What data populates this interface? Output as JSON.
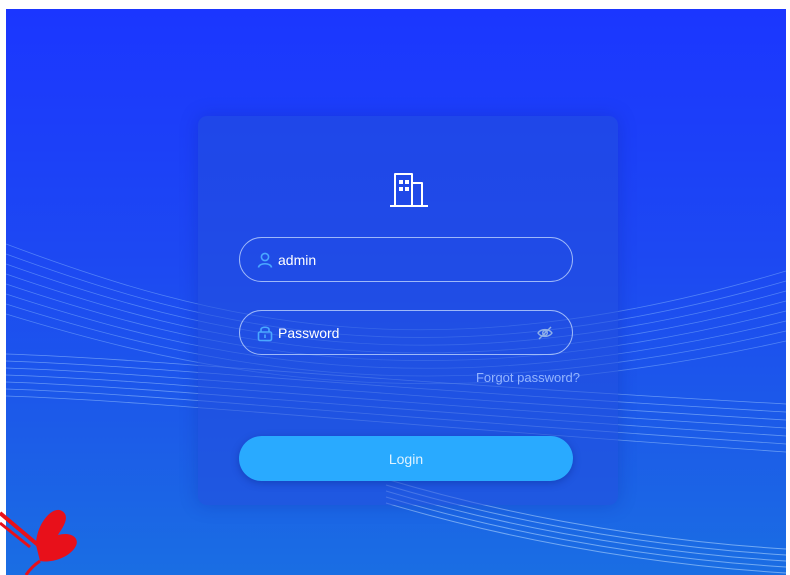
{
  "login": {
    "username_value": "admin",
    "password_placeholder": "Password",
    "forgot_label": "Forgot password?",
    "login_label": "Login"
  },
  "icons": {
    "logo": "building-icon",
    "username": "user-icon",
    "password": "lock-icon",
    "visibility": "eye-off-icon",
    "corner": "butterfly-icon"
  },
  "colors": {
    "background": "#1b3cff",
    "card": "#234edc",
    "accent": "#29aaff",
    "icon": "#4aa8ff",
    "link": "#93b4ff",
    "butterfly": "#e8101a"
  }
}
